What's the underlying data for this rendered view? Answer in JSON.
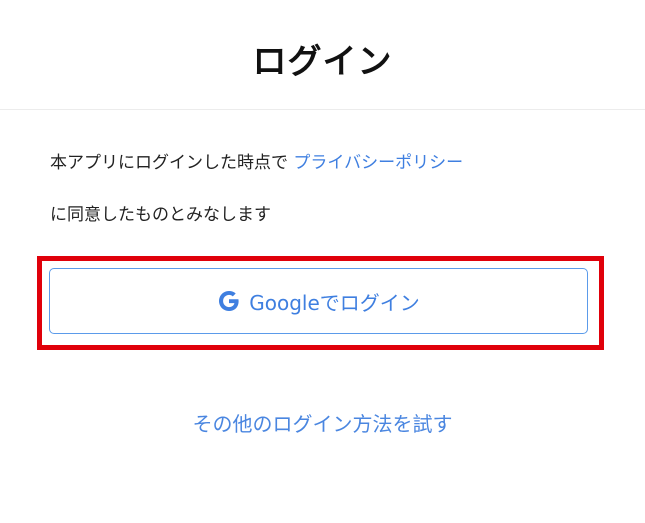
{
  "header": {
    "title": "ログイン"
  },
  "consent": {
    "text_before": "本アプリにログインした時点で ",
    "privacy_link": "プライバシーポリシー",
    "text_after": "に同意したものとみなします"
  },
  "google_button": {
    "icon": "google-g-icon",
    "label": "Googleでログイン"
  },
  "other_methods": {
    "label": "その他のログイン方法を試す"
  },
  "colors": {
    "link": "#3f7fe0",
    "button_border": "#5b9bea",
    "highlight": "#e0000a",
    "title": "#111111"
  }
}
